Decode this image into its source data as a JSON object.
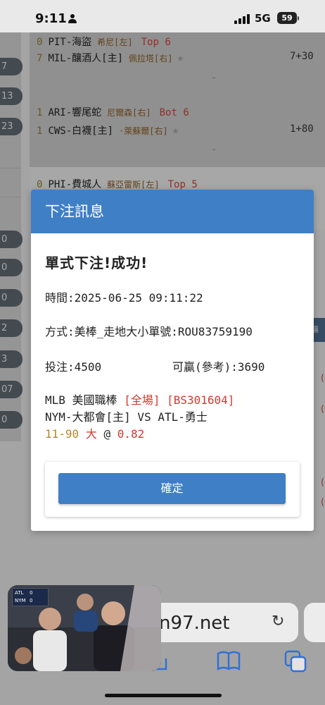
{
  "status": {
    "time": "9:11",
    "network": "5G",
    "battery": "59"
  },
  "left_pills": [
    "7",
    "13",
    "23",
    "0",
    "0",
    "0",
    "2",
    "3",
    "07",
    "0"
  ],
  "cards": [
    {
      "rows": [
        {
          "num": "0",
          "team": "PIT-海盜",
          "pitcher": "希尼[左]",
          "inning": "Top 6",
          "line": ""
        },
        {
          "num": "7",
          "team": "MIL-釀酒人[主]",
          "pitcher": "佩拉塔[右]",
          "inning": "",
          "line": "7+30"
        }
      ]
    },
    {
      "rows": [
        {
          "num": "1",
          "team": "ARI-響尾蛇",
          "pitcher": "尼爾森[右]",
          "inning": "Bot 6",
          "line": ""
        },
        {
          "num": "1",
          "team": "CWS-白襪[主]",
          "pitcher": "·萊蘇爾[右]",
          "inning": "",
          "line": "1+80"
        }
      ]
    },
    {
      "rows": [
        {
          "num": "0",
          "team": "PHI-費城人",
          "pitcher": "蘇亞雷斯[左]",
          "inning": "Top 5",
          "line": ""
        }
      ]
    }
  ],
  "right_strip": {
    "header": "讓球",
    "marks": [
      "(",
      "(",
      "(",
      "("
    ]
  },
  "modal": {
    "title": "下注訊息",
    "success": "單式下注!成功!",
    "time_label": "時間:",
    "time_value": "2025-06-25 09:11:22",
    "method_label": "方式:",
    "method_value": "美棒_走地大小單號:ROU83759190",
    "stake_label": "投注:",
    "stake_value": "4500",
    "win_label": "可贏(參考):",
    "win_value": "3690",
    "league": "MLB 美國職棒",
    "scope": "[全場]",
    "ticket": "[BS301604]",
    "matchup": "NYM-大都會[主] VS ATL-勇士",
    "line_value": "11-90",
    "pick": "大",
    "at": "@",
    "odds": "0.82",
    "confirm": "確定"
  },
  "browser": {
    "url_text": "n97.net"
  },
  "pip": {
    "teams": [
      "ATL",
      "NYM"
    ],
    "scores": [
      "0",
      "0"
    ]
  },
  "colors": {
    "accent": "#3f7fc6",
    "red": "#d23a2e",
    "gold": "#b8862b"
  }
}
